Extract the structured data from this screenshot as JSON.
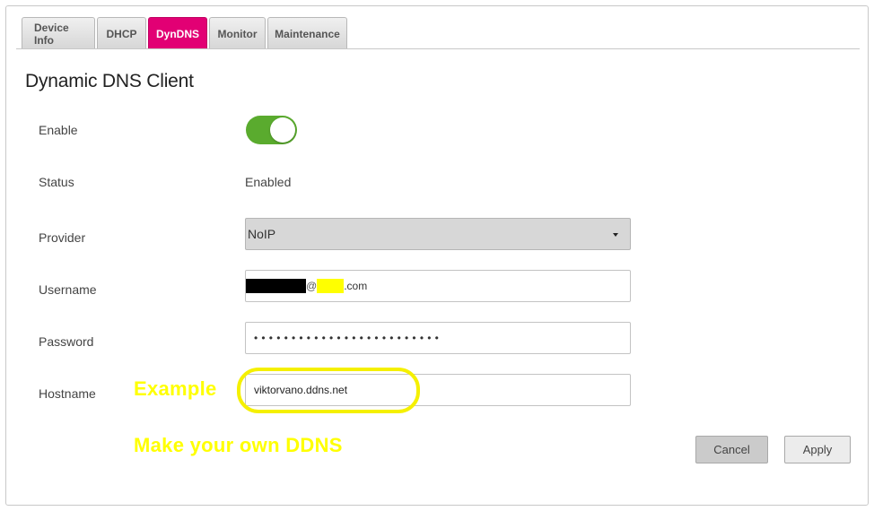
{
  "tabs": [
    {
      "label": "Device Info",
      "active": false
    },
    {
      "label": "DHCP",
      "active": false
    },
    {
      "label": "DynDNS",
      "active": true
    },
    {
      "label": "Monitor",
      "active": false
    },
    {
      "label": "Maintenance",
      "active": false
    }
  ],
  "page": {
    "title": "Dynamic DNS Client"
  },
  "form": {
    "enable": {
      "label": "Enable",
      "on": true
    },
    "status": {
      "label": "Status",
      "value": "Enabled"
    },
    "provider": {
      "label": "Provider",
      "selected": "NoIP"
    },
    "username": {
      "label": "Username",
      "at": "@",
      "domain_suffix": ".com"
    },
    "password": {
      "label": "Password",
      "masked": "•••••••••••••••••••••••••"
    },
    "hostname": {
      "label": "Hostname",
      "value": "viktorvano.ddns.net"
    }
  },
  "annotations": {
    "example": "Example",
    "make_own": "Make your own DDNS"
  },
  "buttons": {
    "cancel": "Cancel",
    "apply": "Apply"
  },
  "colors": {
    "accent": "#e20074",
    "toggle_on": "#5aab2e",
    "annotation": "#ffff00"
  }
}
